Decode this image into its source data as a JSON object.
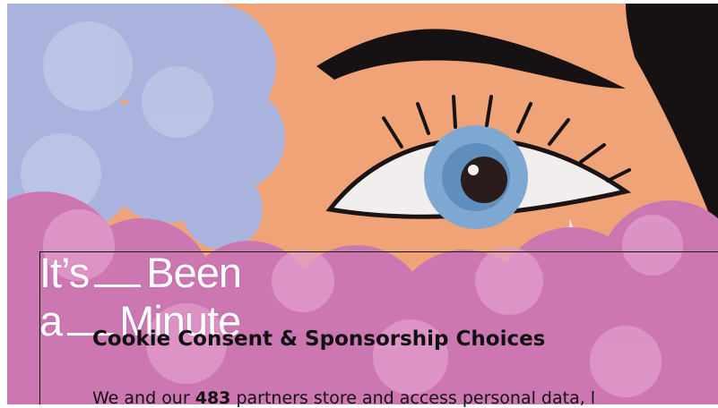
{
  "artwork": {
    "skin": "#efa377",
    "cloud_blue": "#a7b2dc",
    "cloud_pink": "#cf7bb5",
    "iris": "#7aa6cf"
  },
  "show_title": {
    "line1_a": "It’s",
    "line1_b": "Been",
    "line2_a": "a",
    "line2_b": "Minute"
  },
  "consent": {
    "title": "Cookie Consent & Sponsorship Choices",
    "body_prefix": "We and our",
    "partner_count": "483",
    "body_suffix": "partners store and access personal data, l"
  }
}
